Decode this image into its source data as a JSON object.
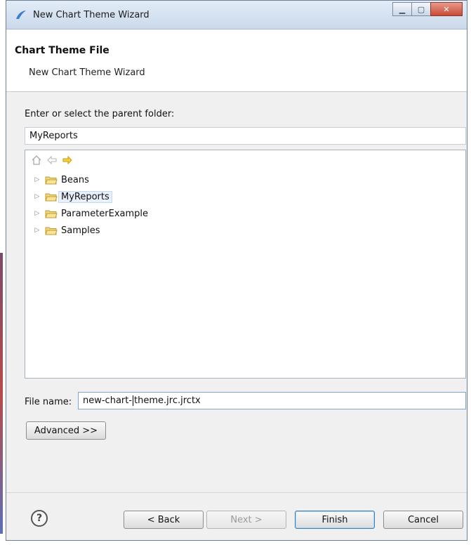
{
  "window": {
    "title": "New Chart Theme Wizard"
  },
  "header": {
    "title": "Chart Theme File",
    "subtitle": "New Chart Theme Wizard"
  },
  "folder": {
    "label": "Enter or select the parent folder:",
    "value": "MyReports"
  },
  "tree": {
    "items": [
      {
        "label": "Beans",
        "selected": false
      },
      {
        "label": "MyReports",
        "selected": true
      },
      {
        "label": "ParameterExample",
        "selected": false
      },
      {
        "label": "Samples",
        "selected": false
      }
    ]
  },
  "file": {
    "label": "File name:",
    "value_part1": "new-chart-",
    "value_part2": "theme.jrc.jrctx"
  },
  "buttons": {
    "advanced": "Advanced >>",
    "back": "< Back",
    "next": "Next >",
    "finish": "Finish",
    "cancel": "Cancel",
    "help": "?"
  },
  "icons": {
    "title": "eclipse-icon",
    "home": "home-icon",
    "back": "back-arrow-icon",
    "forward": "forward-arrow-icon",
    "folder": "folder-icon",
    "expand": "expand-arrow-icon"
  },
  "colors": {
    "forward_arrow": "#e8c218",
    "folder": "#e3c25a"
  }
}
